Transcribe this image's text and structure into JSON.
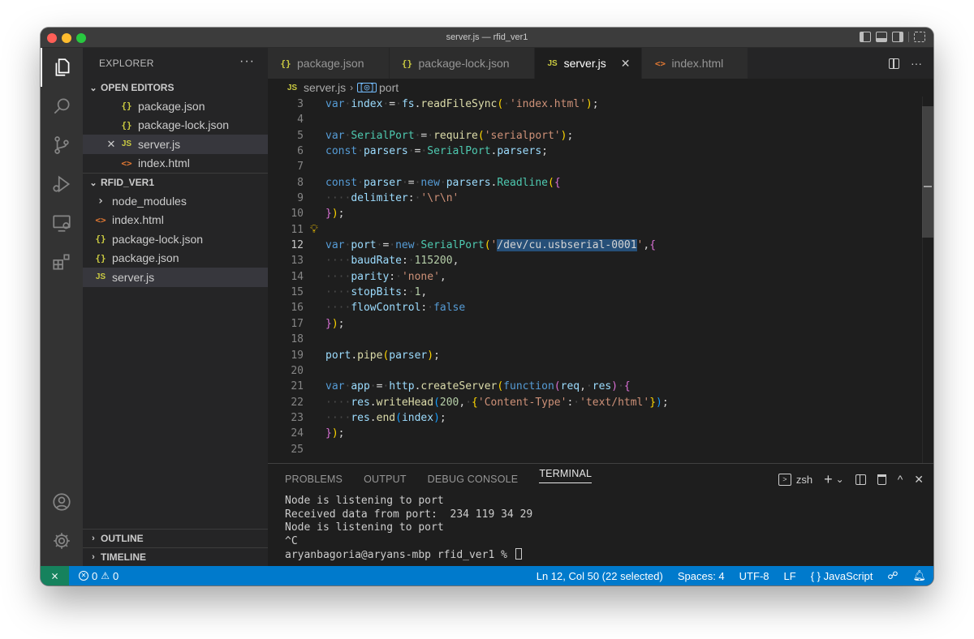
{
  "window": {
    "title": "server.js — rfid_ver1"
  },
  "activity_bar": {
    "items": [
      {
        "name": "explorer-icon",
        "active": true
      },
      {
        "name": "search-icon",
        "active": false
      },
      {
        "name": "source-control-icon",
        "active": false
      },
      {
        "name": "run-debug-icon",
        "active": false
      },
      {
        "name": "remote-explorer-icon",
        "active": false
      },
      {
        "name": "extensions-icon",
        "active": false
      }
    ],
    "bottom_items": [
      "account-icon",
      "settings-gear-icon"
    ]
  },
  "sidebar": {
    "title": "EXPLORER",
    "more_label": "···",
    "open_editors": {
      "title": "OPEN EDITORS",
      "items": [
        {
          "icon": "{}",
          "type": "json",
          "label": "package.json",
          "selected": false,
          "close": ""
        },
        {
          "icon": "{}",
          "type": "json",
          "label": "package-lock.json",
          "selected": false,
          "close": ""
        },
        {
          "icon": "JS",
          "type": "js",
          "label": "server.js",
          "selected": true,
          "close": "✕"
        },
        {
          "icon": "<>",
          "type": "html",
          "label": "index.html",
          "selected": false,
          "close": ""
        }
      ]
    },
    "folder": {
      "title": "RFID_VER1",
      "items": [
        {
          "icon": "›",
          "type": "folder",
          "label": "node_modules",
          "selected": false
        },
        {
          "icon": "<>",
          "type": "html",
          "label": "index.html",
          "selected": false
        },
        {
          "icon": "{}",
          "type": "json",
          "label": "package-lock.json",
          "selected": false
        },
        {
          "icon": "{}",
          "type": "json",
          "label": "package.json",
          "selected": false
        },
        {
          "icon": "JS",
          "type": "js",
          "label": "server.js",
          "selected": true
        }
      ]
    },
    "outline_title": "OUTLINE",
    "timeline_title": "TIMELINE"
  },
  "tabs": [
    {
      "icon": "{}",
      "type": "json",
      "label": "package.json",
      "active": false
    },
    {
      "icon": "{}",
      "type": "json",
      "label": "package-lock.json",
      "active": false
    },
    {
      "icon": "JS",
      "type": "js",
      "label": "server.js",
      "active": true,
      "close": "✕"
    },
    {
      "icon": "<>",
      "type": "html",
      "label": "index.html",
      "active": false
    }
  ],
  "tab_actions": {
    "more": "···"
  },
  "breadcrumb": {
    "file_icon": "JS",
    "file": "server.js",
    "symbol_icon": "[◎]",
    "symbol": "port"
  },
  "editor": {
    "current_line": 12,
    "lightbulb_line": 11,
    "lines": [
      {
        "n": "3",
        "tokens": [
          [
            "kw",
            "var"
          ],
          [
            "ws",
            "·"
          ],
          [
            "vr",
            "index"
          ],
          [
            "ws",
            "·"
          ],
          [
            "",
            "="
          ],
          [
            "ws",
            "·"
          ],
          [
            "vr",
            "fs"
          ],
          [
            "",
            "."
          ],
          [
            "fn",
            "readFileSync"
          ],
          [
            "br1",
            "("
          ],
          [
            "ws",
            "·"
          ],
          [
            "str",
            "'index.html'"
          ],
          [
            "br1",
            ")"
          ],
          [
            "",
            ";"
          ]
        ]
      },
      {
        "n": "4",
        "tokens": []
      },
      {
        "n": "5",
        "tokens": [
          [
            "kw",
            "var"
          ],
          [
            "ws",
            "·"
          ],
          [
            "cls",
            "SerialPort"
          ],
          [
            "ws",
            "·"
          ],
          [
            "",
            "="
          ],
          [
            "ws",
            "·"
          ],
          [
            "fn",
            "require"
          ],
          [
            "br1",
            "("
          ],
          [
            "str",
            "'serialport'"
          ],
          [
            "br1",
            ")"
          ],
          [
            "",
            ";"
          ]
        ]
      },
      {
        "n": "6",
        "tokens": [
          [
            "kw",
            "const"
          ],
          [
            "ws",
            "·"
          ],
          [
            "vr",
            "parsers"
          ],
          [
            "ws",
            "·"
          ],
          [
            "",
            "="
          ],
          [
            "ws",
            "·"
          ],
          [
            "cls",
            "SerialPort"
          ],
          [
            "",
            "."
          ],
          [
            "vr",
            "parsers"
          ],
          [
            "",
            ";"
          ]
        ]
      },
      {
        "n": "7",
        "tokens": []
      },
      {
        "n": "8",
        "tokens": [
          [
            "kw",
            "const"
          ],
          [
            "ws",
            "·"
          ],
          [
            "vr",
            "parser"
          ],
          [
            "ws",
            "·"
          ],
          [
            "",
            "="
          ],
          [
            "ws",
            "·"
          ],
          [
            "kw",
            "new"
          ],
          [
            "ws",
            "·"
          ],
          [
            "vr",
            "parsers"
          ],
          [
            "",
            "."
          ],
          [
            "cls",
            "Readline"
          ],
          [
            "br1",
            "("
          ],
          [
            "br2",
            "{"
          ]
        ]
      },
      {
        "n": "9",
        "tokens": [
          [
            "ws",
            "····"
          ],
          [
            "vr",
            "delimiter"
          ],
          [
            "",
            ":"
          ],
          [
            "ws",
            "·"
          ],
          [
            "str",
            "'\\r\\n'"
          ]
        ]
      },
      {
        "n": "10",
        "tokens": [
          [
            "br2",
            "}"
          ],
          [
            "br1",
            ")"
          ],
          [
            "",
            ";"
          ]
        ]
      },
      {
        "n": "11",
        "tokens": []
      },
      {
        "n": "12",
        "tokens": [
          [
            "kw",
            "var"
          ],
          [
            "ws",
            "·"
          ],
          [
            "vr",
            "port"
          ],
          [
            "ws",
            "·"
          ],
          [
            "",
            "="
          ],
          [
            "ws",
            "·"
          ],
          [
            "kw",
            "new"
          ],
          [
            "ws",
            "·"
          ],
          [
            "cls",
            "SerialPort"
          ],
          [
            "br1",
            "("
          ],
          [
            "str",
            "'"
          ],
          [
            "sel",
            "/dev/cu.usbserial-0001"
          ],
          [
            "str",
            "'"
          ],
          [
            "",
            ","
          ],
          [
            "br2",
            "{"
          ]
        ]
      },
      {
        "n": "13",
        "tokens": [
          [
            "ws",
            "····"
          ],
          [
            "vr",
            "baudRate"
          ],
          [
            "",
            ":"
          ],
          [
            "ws",
            "·"
          ],
          [
            "num",
            "115200"
          ],
          [
            "",
            ","
          ]
        ]
      },
      {
        "n": "14",
        "tokens": [
          [
            "ws",
            "····"
          ],
          [
            "vr",
            "parity"
          ],
          [
            "",
            ":"
          ],
          [
            "ws",
            "·"
          ],
          [
            "str",
            "'none'"
          ],
          [
            "",
            ","
          ]
        ]
      },
      {
        "n": "15",
        "tokens": [
          [
            "ws",
            "····"
          ],
          [
            "vr",
            "stopBits"
          ],
          [
            "",
            ":"
          ],
          [
            "ws",
            "·"
          ],
          [
            "num",
            "1"
          ],
          [
            "",
            ","
          ]
        ]
      },
      {
        "n": "16",
        "tokens": [
          [
            "ws",
            "····"
          ],
          [
            "vr",
            "flowControl"
          ],
          [
            "",
            ":"
          ],
          [
            "ws",
            "·"
          ],
          [
            "kw",
            "false"
          ]
        ]
      },
      {
        "n": "17",
        "tokens": [
          [
            "br2",
            "}"
          ],
          [
            "br1",
            ")"
          ],
          [
            "",
            ";"
          ]
        ]
      },
      {
        "n": "18",
        "tokens": []
      },
      {
        "n": "19",
        "tokens": [
          [
            "vr",
            "port"
          ],
          [
            "",
            "."
          ],
          [
            "fn",
            "pipe"
          ],
          [
            "br1",
            "("
          ],
          [
            "vr",
            "parser"
          ],
          [
            "br1",
            ")"
          ],
          [
            "",
            ";"
          ]
        ]
      },
      {
        "n": "20",
        "tokens": []
      },
      {
        "n": "21",
        "tokens": [
          [
            "kw",
            "var"
          ],
          [
            "ws",
            "·"
          ],
          [
            "vr",
            "app"
          ],
          [
            "ws",
            "·"
          ],
          [
            "",
            "="
          ],
          [
            "ws",
            "·"
          ],
          [
            "vr",
            "http"
          ],
          [
            "",
            "."
          ],
          [
            "fn",
            "createServer"
          ],
          [
            "br1",
            "("
          ],
          [
            "kw",
            "function"
          ],
          [
            "br2",
            "("
          ],
          [
            "vr",
            "req"
          ],
          [
            "",
            ","
          ],
          [
            "ws",
            "·"
          ],
          [
            "vr",
            "res"
          ],
          [
            "br2",
            ")"
          ],
          [
            "ws",
            "·"
          ],
          [
            "br2",
            "{"
          ]
        ]
      },
      {
        "n": "22",
        "tokens": [
          [
            "ws",
            "····"
          ],
          [
            "vr",
            "res"
          ],
          [
            "",
            "."
          ],
          [
            "fn",
            "writeHead"
          ],
          [
            "br3",
            "("
          ],
          [
            "num",
            "200"
          ],
          [
            "",
            ","
          ],
          [
            "ws",
            "·"
          ],
          [
            "br1",
            "{"
          ],
          [
            "str",
            "'Content-Type'"
          ],
          [
            "",
            ":"
          ],
          [
            "ws",
            "·"
          ],
          [
            "str",
            "'text/html'"
          ],
          [
            "br1",
            "}"
          ],
          [
            "br3",
            ")"
          ],
          [
            "",
            ";"
          ]
        ]
      },
      {
        "n": "23",
        "tokens": [
          [
            "ws",
            "····"
          ],
          [
            "vr",
            "res"
          ],
          [
            "",
            "."
          ],
          [
            "fn",
            "end"
          ],
          [
            "br3",
            "("
          ],
          [
            "vr",
            "index"
          ],
          [
            "br3",
            ")"
          ],
          [
            "",
            ";"
          ]
        ]
      },
      {
        "n": "24",
        "tokens": [
          [
            "br2",
            "}"
          ],
          [
            "br1",
            ")"
          ],
          [
            "",
            ";"
          ]
        ]
      },
      {
        "n": "25",
        "tokens": []
      }
    ]
  },
  "panel": {
    "tabs": [
      "PROBLEMS",
      "OUTPUT",
      "DEBUG CONSOLE",
      "TERMINAL"
    ],
    "active_tab": "TERMINAL",
    "shell_icon": ">",
    "shell": "zsh",
    "add_label": "+",
    "dropdown_label": "⌄",
    "chevron_up": "^",
    "close_label": "✕",
    "terminal_lines": [
      "Node is listening to port",
      "Received data from port:  234 119 34 29",
      "Node is listening to port",
      "^C"
    ],
    "prompt": "aryanbagoria@aryans-mbp rfid_ver1 % "
  },
  "statusbar": {
    "remote_icon": "⨯",
    "errors": "0",
    "warnings": "0",
    "position": "Ln 12, Col 50 (22 selected)",
    "spaces": "Spaces: 4",
    "encoding": "UTF-8",
    "eol": "LF",
    "language_icon": "{ }",
    "language": "JavaScript",
    "colors": {
      "bar": "#007acc",
      "remote": "#16825d"
    }
  }
}
